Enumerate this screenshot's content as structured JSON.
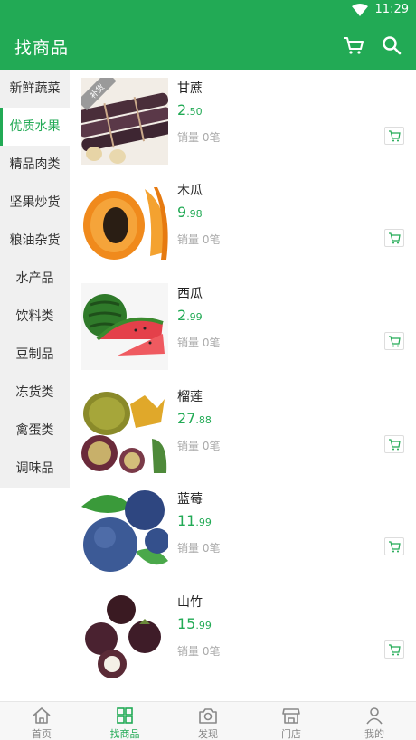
{
  "status": {
    "time": "11:29"
  },
  "header": {
    "title": "找商品"
  },
  "sidebar": {
    "items": [
      {
        "label": "新鲜蔬菜"
      },
      {
        "label": "优质水果"
      },
      {
        "label": "精品肉类"
      },
      {
        "label": "坚果炒货"
      },
      {
        "label": "粮油杂货"
      },
      {
        "label": "水产品"
      },
      {
        "label": "饮料类"
      },
      {
        "label": "豆制品"
      },
      {
        "label": "冻货类"
      },
      {
        "label": "禽蛋类"
      },
      {
        "label": "调味品"
      }
    ],
    "active_index": 1
  },
  "products": [
    {
      "name": "甘蔗",
      "price_int": "2",
      "price_dec": ".50",
      "sales": "销量 0笔",
      "badge": "补货"
    },
    {
      "name": "木瓜",
      "price_int": "9",
      "price_dec": ".98",
      "sales": "销量 0笔"
    },
    {
      "name": "西瓜",
      "price_int": "2",
      "price_dec": ".99",
      "sales": "销量 0笔"
    },
    {
      "name": "榴莲",
      "price_int": "27",
      "price_dec": ".88",
      "sales": "销量 0笔"
    },
    {
      "name": "蓝莓",
      "price_int": "11",
      "price_dec": ".99",
      "sales": "销量 0笔"
    },
    {
      "name": "山竹",
      "price_int": "15",
      "price_dec": ".99",
      "sales": "销量 0笔"
    }
  ],
  "bottom_nav": [
    {
      "label": "首页"
    },
    {
      "label": "找商品"
    },
    {
      "label": "发现"
    },
    {
      "label": "门店"
    },
    {
      "label": "我的"
    }
  ],
  "colors": {
    "brand": "#22aa55",
    "sidebar_bg": "#f0f0f0",
    "muted": "#aaaaaa"
  }
}
